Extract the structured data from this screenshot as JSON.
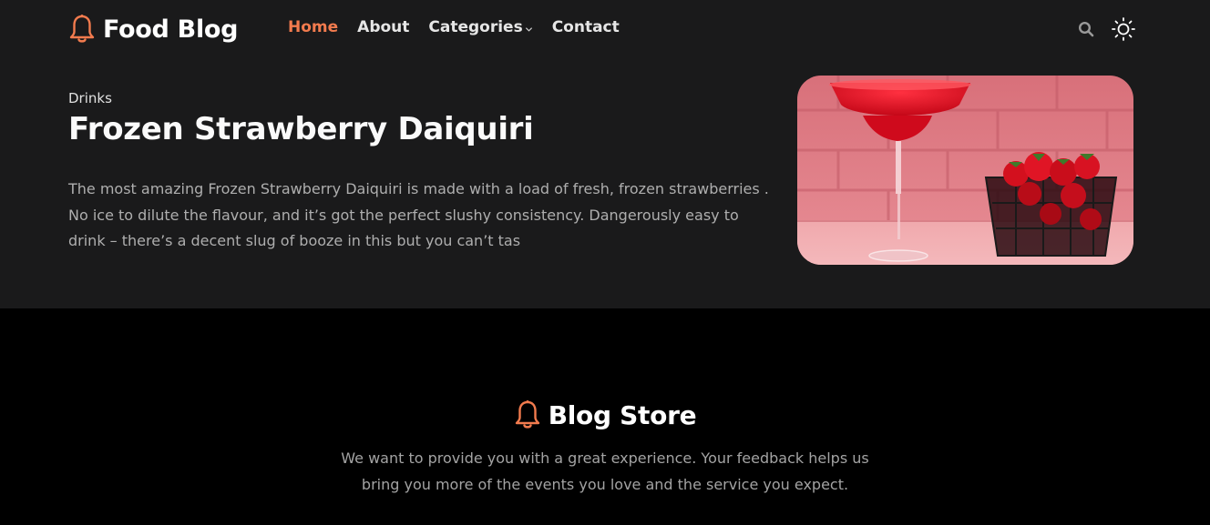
{
  "header": {
    "brand": "Food Blog",
    "nav": [
      {
        "label": "Home",
        "active": true
      },
      {
        "label": "About",
        "active": false
      },
      {
        "label": "Categories",
        "active": false,
        "dropdown": true
      },
      {
        "label": "Contact",
        "active": false
      }
    ],
    "icons": [
      "bell-icon",
      "search-icon",
      "sun-icon"
    ]
  },
  "hero": {
    "category": "Drinks",
    "title": "Frozen Strawberry Daiquiri",
    "description": "The most amazing Frozen Strawberry Daiquiri is made with a load of fresh, frozen strawberries . No ice to dilute the flavour, and it’s got the perfect slushy consistency. Dangerously easy to drink – there’s a decent slug of booze in this but you can’t tas"
  },
  "footer": {
    "brand": "Blog Store",
    "desc_line1": "We want to provide you with a great experience. Your feedback helps us",
    "desc_line2": "bring you more of the events you love and the service you expect."
  },
  "colors": {
    "accent": "#f27b4e",
    "top_bg": "#1a1a1b",
    "bottom_bg": "#000000"
  }
}
